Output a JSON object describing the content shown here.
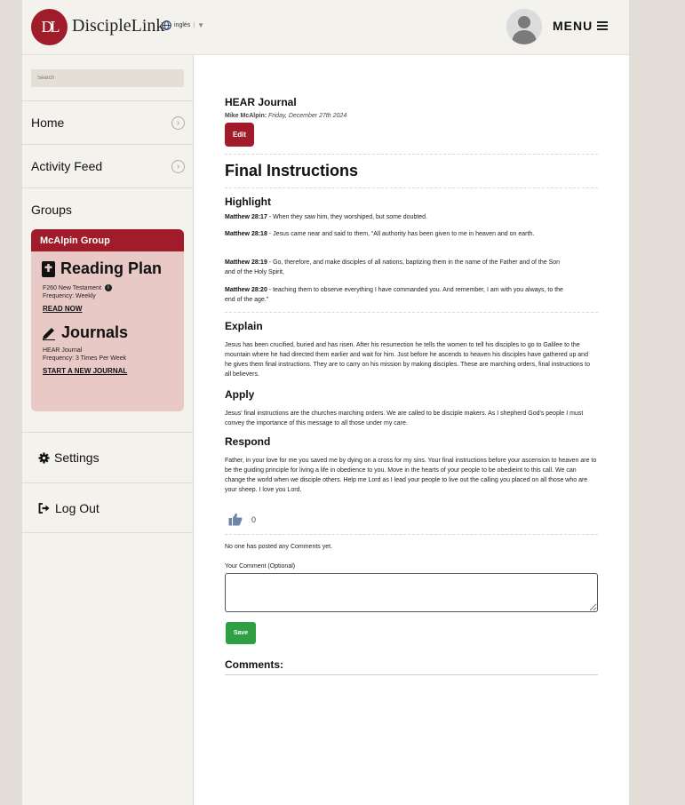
{
  "header": {
    "logo_mark": "DL",
    "logo_text": "DiscipleLink",
    "language": "inglés",
    "language_sep": "|",
    "menu_label": "MENU"
  },
  "sidebar": {
    "search_placeholder": "Search",
    "items": [
      {
        "label": "Home"
      },
      {
        "label": "Activity Feed"
      },
      {
        "label": "Groups"
      }
    ],
    "group": {
      "name": "McAlpin Group",
      "reading_plan_title": "Reading Plan",
      "plan_name": "F260 New Testament",
      "plan_frequency": "Frequency: Weekly",
      "read_now": "READ NOW",
      "journals_title": "Journals",
      "journal_type": "HEAR Journal",
      "journal_frequency": "Frequency: 3 Times Per Week",
      "start_journal": "START A NEW JOURNAL"
    },
    "settings_label": "Settings",
    "logout_label": "Log Out"
  },
  "main": {
    "journal_label": "HEAR Journal",
    "author": "Mike McAlpin:",
    "date": "Friday, December 27th 2024",
    "edit_label": "Edit",
    "title": "Final Instructions",
    "highlight_title": "Highlight",
    "verses": [
      {
        "ref": "Matthew 28:17",
        "text": " - When they saw him, they worshiped, but some doubted."
      },
      {
        "ref": "Matthew 28:18",
        "text": " - Jesus came near and said to them, “All authority has been given to me in heaven and on earth."
      },
      {
        "ref": "Matthew 28:19",
        "text": " - Go, therefore, and make disciples of all nations, baptizing them in the name of the Father and of the Son and of the Holy Spirit,"
      },
      {
        "ref": "Matthew 28:20",
        "text": " - teaching them to observe everything I have commanded you. And remember, I am with you always, to the end of the age.”"
      }
    ],
    "explain_title": "Explain",
    "explain_text": "Jesus has  been crucified, buried and has risen. After his resurrection he tells the women to tell his disciples to go to Galilee to the mountain where he had directed them earlier and wait for him. Just before he ascends to heaven his disciples have gathered up and he gives them final instructions. They are to carry on his mission by making disciples. These are marching orders, final instructions to all believers.",
    "apply_title": "Apply",
    "apply_text": "Jesus' final instructions are the churches marching orders. We are called to be disciple makers. As I shepherd God's people I must convey the importance of this message to all those under my care.",
    "respond_title": "Respond",
    "respond_text": "Father, in your love for me you saved me by dying on a cross for my sins. Your final instructions before your ascension to heaven are to be the guiding principle for living a life in obedience to you. Move in the hearts of your people to be obedieint to this call. We can change the world when we disciple others. Help me Lord as I lead your people to live out the calling you placed on all those who are your sheep. I love you Lord.",
    "like_count": "0",
    "no_comments": "No one has posted any Comments yet.",
    "comment_label": "Your Comment (Optional)",
    "save_label": "Save",
    "comments_heading": "Comments:"
  },
  "icons": {
    "globe": "globe-icon",
    "user": "user-avatar-icon",
    "menu": "hamburger-icon",
    "arrow": "chevron-right-circle-icon",
    "book": "bible-icon",
    "pen": "pen-icon",
    "gear": "gear-icon",
    "logout": "sign-out-icon",
    "thumb": "thumbs-up-icon",
    "info": "info-icon"
  },
  "colors": {
    "brand": "#a01c2a",
    "save": "#2ea043",
    "card": "#e8c9c6",
    "thumb": "#6b86a8"
  }
}
